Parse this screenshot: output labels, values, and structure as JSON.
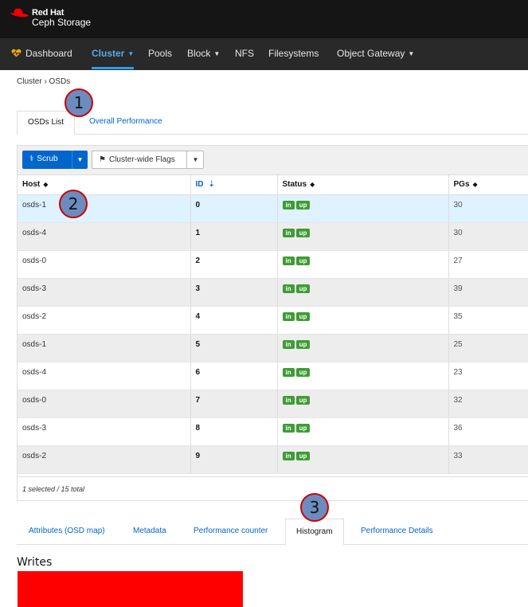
{
  "brand": {
    "line1": "Red Hat",
    "line2": "Ceph Storage"
  },
  "nav": {
    "dashboard": "Dashboard",
    "cluster": "Cluster",
    "pools": "Pools",
    "block": "Block",
    "nfs": "NFS",
    "filesystems": "Filesystems",
    "object_gateway": "Object Gateway"
  },
  "breadcrumb": "Cluster  ›  OSDs",
  "top_tabs": [
    "OSDs List",
    "Overall Performance"
  ],
  "toolbar": {
    "scrub": "Scrub",
    "flags": "Cluster-wide Flags"
  },
  "columns": [
    "Host",
    "ID",
    "Status",
    "PGs"
  ],
  "rows": [
    {
      "host": "osds-1",
      "id": "0",
      "status": [
        "in",
        "up"
      ],
      "pgs": "30"
    },
    {
      "host": "osds-4",
      "id": "1",
      "status": [
        "in",
        "up"
      ],
      "pgs": "30"
    },
    {
      "host": "osds-0",
      "id": "2",
      "status": [
        "in",
        "up"
      ],
      "pgs": "27"
    },
    {
      "host": "osds-3",
      "id": "3",
      "status": [
        "in",
        "up"
      ],
      "pgs": "39"
    },
    {
      "host": "osds-2",
      "id": "4",
      "status": [
        "in",
        "up"
      ],
      "pgs": "35"
    },
    {
      "host": "osds-1",
      "id": "5",
      "status": [
        "in",
        "up"
      ],
      "pgs": "25"
    },
    {
      "host": "osds-4",
      "id": "6",
      "status": [
        "in",
        "up"
      ],
      "pgs": "23"
    },
    {
      "host": "osds-0",
      "id": "7",
      "status": [
        "in",
        "up"
      ],
      "pgs": "32"
    },
    {
      "host": "osds-3",
      "id": "8",
      "status": [
        "in",
        "up"
      ],
      "pgs": "36"
    },
    {
      "host": "osds-2",
      "id": "9",
      "status": [
        "in",
        "up"
      ],
      "pgs": "33"
    }
  ],
  "selection_summary": "1 selected / 15 total",
  "bottom_tabs": [
    "Attributes (OSD map)",
    "Metadata",
    "Performance counter",
    "Histogram",
    "Performance Details"
  ],
  "section_title": "Writes",
  "markers": [
    "1",
    "2",
    "3"
  ],
  "colors": {
    "accent": "#0066cc",
    "nav_active": "#2b9af3",
    "badge": "#3f9c35",
    "selected_row": "#def3ff",
    "histogram": "#ff0000"
  }
}
